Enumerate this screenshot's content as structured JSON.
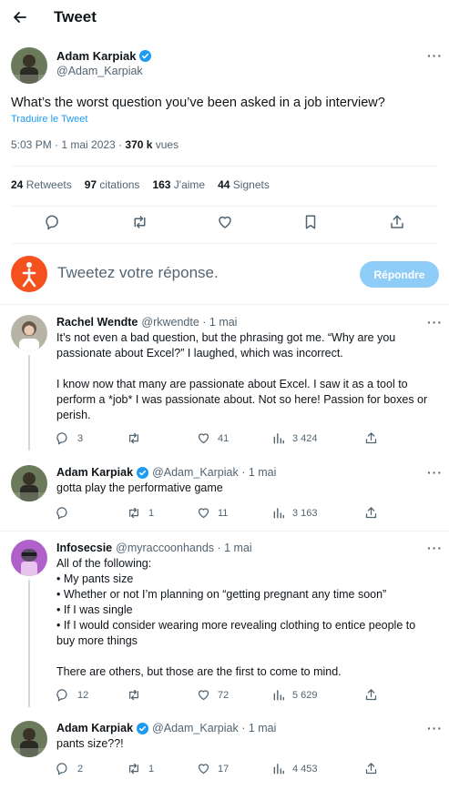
{
  "header": {
    "title": "Tweet"
  },
  "tweet": {
    "name": "Adam Karpiak",
    "handle": "@Adam_Karpiak",
    "text": "What’s the worst question you’ve been asked in a job interview?",
    "translate_label": "Traduire le Tweet",
    "time": "5:03 PM · 1 mai 2023 · ",
    "views_count": "370 k",
    "views_label": " vues",
    "stats": {
      "retweets_count": "24",
      "retweets_label": " Retweets",
      "quotes_count": "97",
      "quotes_label": " citations",
      "likes_count": "163",
      "likes_label": " J'aime",
      "bookmarks_count": "44",
      "bookmarks_label": " Signets"
    }
  },
  "composer": {
    "placeholder": "Tweetez votre réponse.",
    "button_label": "Répondre"
  },
  "replies": [
    {
      "name": "Rachel Wendte",
      "meta": "@rkwendte · 1 mai",
      "lines": [
        "It’s not even a bad question, but the phrasing got me. “Why are you",
        "passionate about Excel?” I laughed, which was incorrect.",
        "",
        "I know now that many are passionate about Excel. I saw it as a tool to",
        "perform a *job* I was passionate about. Not so here! Passion for boxes or",
        "perish."
      ],
      "replies": "3",
      "retweets": "",
      "likes": "41",
      "views": "3 424"
    },
    {
      "name": "Adam Karpiak",
      "meta": "@Adam_Karpiak · 1 mai",
      "lines": [
        "gotta play the performative game"
      ],
      "replies": "",
      "retweets": "1",
      "likes": "11",
      "views": "3 163"
    },
    {
      "name": "Infosecsie",
      "meta": "@myraccoonhands · 1 mai",
      "lines": [
        "All of the following:",
        "• My pants size",
        "• Whether or not I’m planning on “getting pregnant any time soon”",
        "• If I was single",
        "• If I would consider wearing more revealing clothing to entice people to",
        "buy more things",
        "",
        "There are others, but those are the first to come to mind."
      ],
      "replies": "12",
      "retweets": "",
      "likes": "72",
      "views": "5 629"
    },
    {
      "name": "Adam Karpiak",
      "meta": "@Adam_Karpiak · 1 mai",
      "lines": [
        "pants size??!"
      ],
      "replies": "2",
      "retweets": "1",
      "likes": "17",
      "views": "4 453"
    }
  ],
  "colors": {
    "accent": "#1d9bf0",
    "button_disabled": "#8ecdf8",
    "muted": "#536471",
    "avatar_reply": "#f4511e"
  },
  "icons": [
    "back-arrow-icon",
    "verified-badge-icon",
    "more-icon",
    "reply-icon",
    "retweet-icon",
    "like-icon",
    "bookmark-icon",
    "share-icon",
    "views-icon"
  ]
}
